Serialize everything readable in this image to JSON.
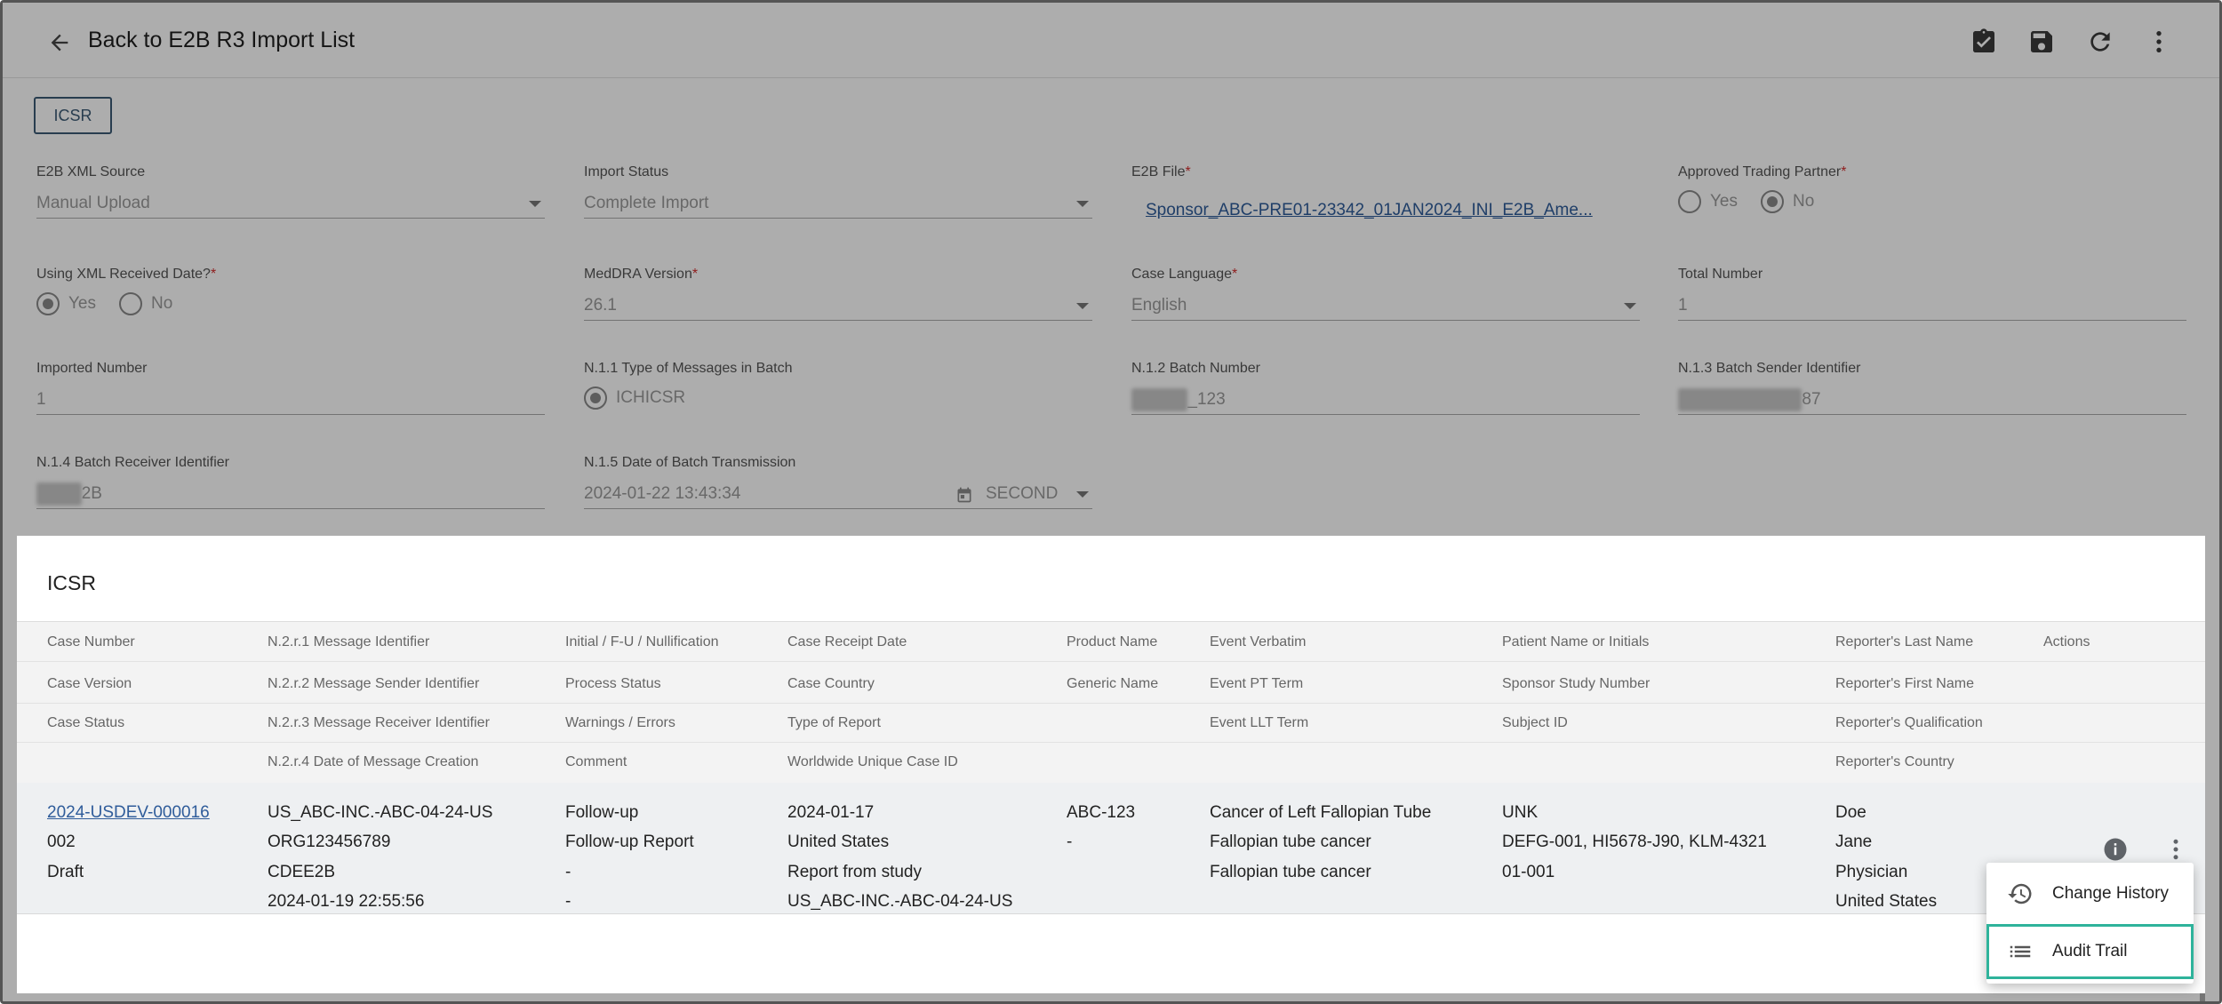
{
  "header": {
    "title": "Back to E2B R3 Import List",
    "icons": [
      "arrow-left-icon",
      "clipboard-check-icon",
      "save-icon",
      "refresh-icon",
      "more-vertical-icon"
    ]
  },
  "tab": {
    "label": "ICSR"
  },
  "form": {
    "xml_source": {
      "label": "E2B XML Source",
      "value": "Manual Upload"
    },
    "import_status": {
      "label": "Import Status",
      "value": "Complete Import"
    },
    "e2b_file": {
      "label": "E2B File",
      "value": "Sponsor_ABC-PRE01-23342_01JAN2024_INI_E2B_Ame..."
    },
    "trading_partner": {
      "label": "Approved Trading Partner",
      "yes": "Yes",
      "no": "No",
      "selected": "No"
    },
    "using_xml_date": {
      "label": "Using XML Received Date?",
      "yes": "Yes",
      "no": "No",
      "selected": "Yes"
    },
    "meddra": {
      "label": "MedDRA Version",
      "value": "26.1"
    },
    "case_language": {
      "label": "Case Language",
      "value": "English"
    },
    "total_number": {
      "label": "Total Number",
      "value": "1"
    },
    "imported_number": {
      "label": "Imported Number",
      "value": "1"
    },
    "type_of_messages": {
      "label": "N.1.1 Type of Messages in Batch",
      "option": "ICHICSR"
    },
    "batch_number": {
      "label": "N.1.2 Batch Number",
      "value": "_123"
    },
    "batch_sender": {
      "label": "N.1.3 Batch Sender Identifier",
      "value": "87"
    },
    "batch_receiver": {
      "label": "N.1.4 Batch Receiver Identifier",
      "value": "2B"
    },
    "batch_date": {
      "label": "N.1.5 Date of Batch Transmission",
      "value": "2024-01-22 13:43:34",
      "precision": "SECOND"
    }
  },
  "panel": {
    "title": "ICSR",
    "headers": [
      [
        "Case Number",
        "N.2.r.1 Message Identifier",
        "Initial / F-U / Nullification",
        "Case Receipt Date",
        "Product Name",
        "Event Verbatim",
        "Patient Name or Initials",
        "Reporter's Last Name",
        "Actions"
      ],
      [
        "Case Version",
        "N.2.r.2 Message Sender Identifier",
        "Process Status",
        "Case Country",
        "Generic Name",
        "Event PT Term",
        "Sponsor Study Number",
        "Reporter's First Name"
      ],
      [
        "Case Status",
        "N.2.r.3 Message Receiver Identifier",
        "Warnings / Errors",
        "Type of Report",
        "",
        "Event LLT Term",
        "Subject ID",
        "Reporter's Qualification"
      ],
      [
        "",
        "N.2.r.4 Date of Message Creation",
        "Comment",
        "Worldwide Unique Case ID",
        "",
        "",
        "",
        "Reporter's Country"
      ]
    ],
    "row": {
      "case_number": "2024-USDEV-000016",
      "case_version": "002",
      "case_status": "Draft",
      "msg_identifier": "US_ABC-INC.-ABC-04-24-US",
      "msg_sender": "ORG123456789",
      "msg_receiver": "CDEE2B",
      "msg_date": "2024-01-19 22:55:56",
      "initial_fu": "Follow-up",
      "process_status": "Follow-up Report",
      "warnings": "-",
      "comment": "-",
      "receipt_date": "2024-01-17",
      "case_country": "United States",
      "report_type": "Report from study",
      "worldwide_id": "US_ABC-INC.-ABC-04-24-US",
      "product_name": "ABC-123",
      "generic_name": "-",
      "event_verbatim": "Cancer of Left Fallopian Tube",
      "event_pt": "Fallopian tube cancer",
      "event_llt": "Fallopian tube cancer",
      "patient": "UNK",
      "study_number": "DEFG-001, HI5678-J90, KLM-4321",
      "subject_id": "01-001",
      "reporter_last": "Doe",
      "reporter_first": "Jane",
      "reporter_qual": "Physician",
      "reporter_country": "United States"
    }
  },
  "menu": {
    "change_history": "Change History",
    "audit_trail": "Audit Trail"
  }
}
